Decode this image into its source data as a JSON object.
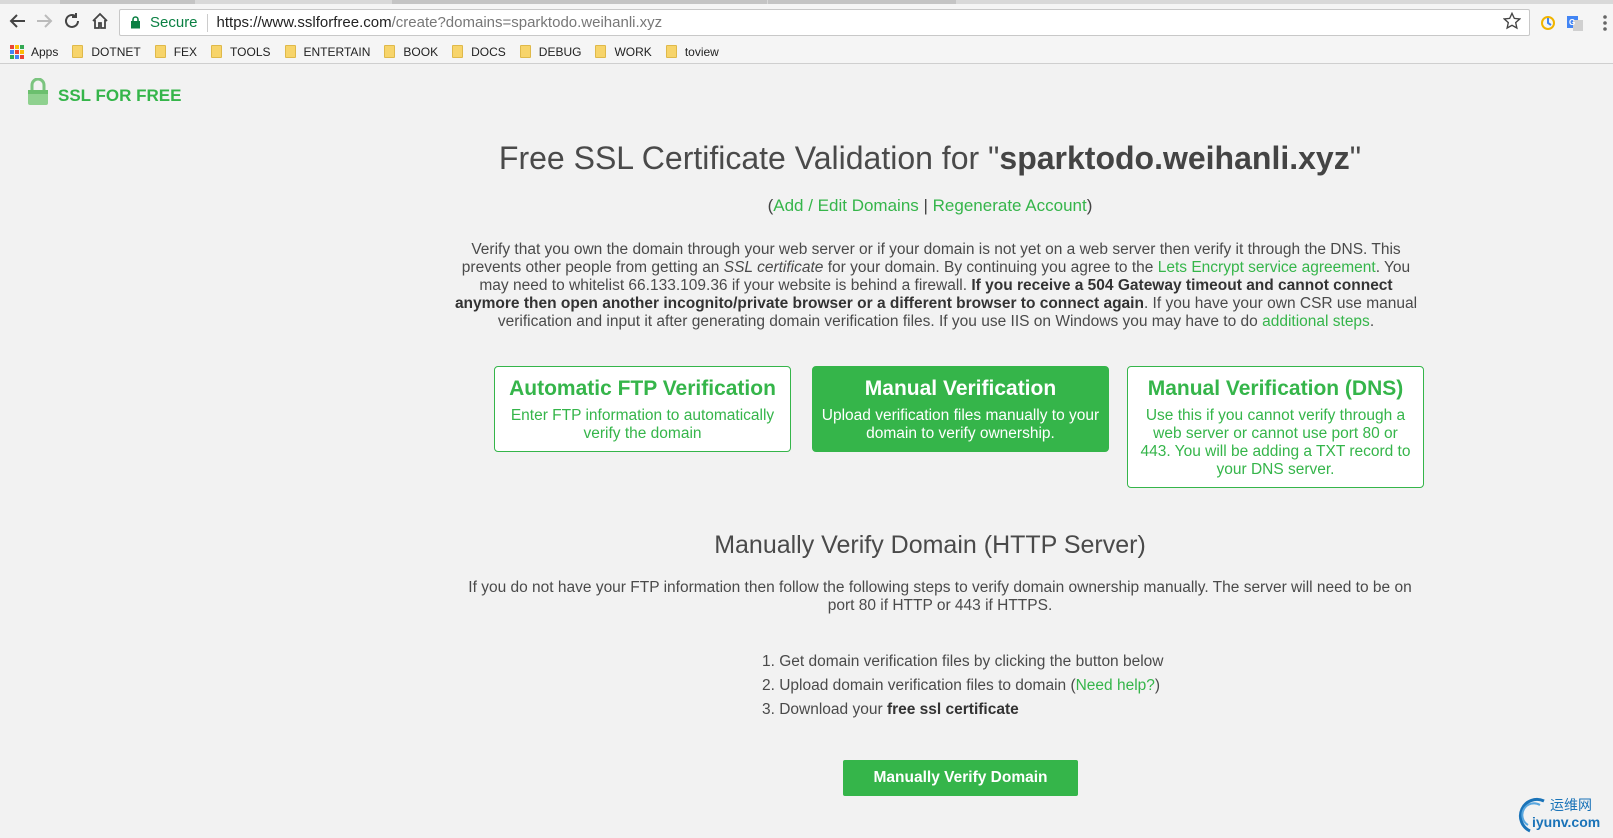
{
  "browser": {
    "secure_label": "Secure",
    "url_host": "https://www.sslforfree.com",
    "url_path": "/create?domains=sparktodo.weihanli.xyz",
    "bookmarks": [
      "Apps",
      "DOTNET",
      "FEX",
      "TOOLS",
      "ENTERTAIN",
      "BOOK",
      "DOCS",
      "DEBUG",
      "WORK",
      "toview"
    ]
  },
  "brand": {
    "name": "SSL FOR FREE",
    "color": "#35b54a"
  },
  "header": {
    "title_prefix": "Free SSL Certificate Validation for \"",
    "domain": "sparktodo.weihanli.xyz",
    "title_suffix": "\"",
    "link_add_edit": "Add / Edit Domains",
    "link_regenerate": "Regenerate Account"
  },
  "intro": {
    "t1": "Verify that you own the domain through your web server or if your domain is not yet on a web server then verify it through the DNS. This prevents other people from getting an ",
    "t2": "SSL certificate",
    "t3": " for your domain. By continuing you agree to the ",
    "t4": "Lets Encrypt service agreement",
    "t5": ". You may need to whitelist 66.133.109.36 if your website is behind a firewall. ",
    "t6": "If you receive a 504 Gateway timeout and cannot connect anymore then open another incognito/private browser or a different browser to connect again",
    "t7": ". If you have your own CSR use manual verification and input it after generating domain verification files. If you use IIS on Windows you may have to do ",
    "t8": "additional steps",
    "t9": "."
  },
  "cards": [
    {
      "title": "Automatic FTP Verification",
      "desc": "Enter FTP information to automatically verify the domain"
    },
    {
      "title": "Manual Verification",
      "desc": "Upload verification files manually to your domain to verify ownership."
    },
    {
      "title": "Manual Verification (DNS)",
      "desc": "Use this if you cannot verify through a web server or cannot use port 80 or 443. You will be adding a TXT record to your DNS server."
    }
  ],
  "manual": {
    "heading": "Manually Verify Domain (HTTP Server)",
    "paragraph": "If you do not have your FTP information then follow the following steps to verify domain ownership manually. The server will need to be on port 80 if HTTP or 443 if HTTPS.",
    "step1": "1. Get domain verification files by clicking the button below",
    "step2_a": "2. Upload domain verification files to domain (",
    "step2_link": "Need help?",
    "step2_b": ")",
    "step3_a": "3. Download your ",
    "step3_b": "free ssl certificate",
    "button": "Manually Verify Domain"
  },
  "watermark": {
    "cn": "运维网",
    "en": "iyunv.com"
  }
}
